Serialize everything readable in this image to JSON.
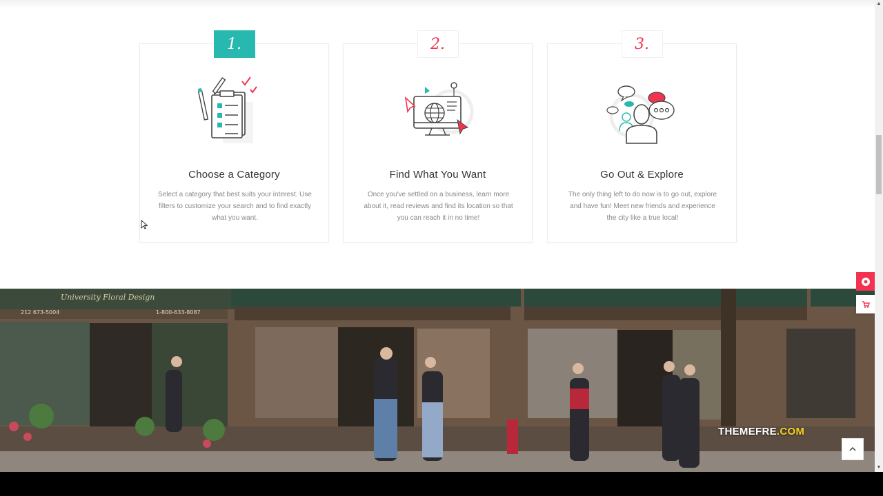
{
  "steps": [
    {
      "number": "1.",
      "title": "Choose a Category",
      "description": "Select a category that best suits your interest. Use filters to customize your search and to find exactly what you want.",
      "icon": "checklist-icon"
    },
    {
      "number": "2.",
      "title": "Find What You Want",
      "description": "Once you've settled on a business, learn more about it, read reviews and find its location so that you can reach it in no time!",
      "icon": "globe-monitor-icon"
    },
    {
      "number": "3.",
      "title": "Go Out & Explore",
      "description": "The only thing left to do now is to go out, explore and have fun! Meet new friends and experience the city like a true local!",
      "icon": "people-chat-icon"
    }
  ],
  "watermark": {
    "text": "THEMEFRE",
    "suffix": ".COM"
  },
  "photo": {
    "shop_sign": "University Floral Design",
    "phone_left": "212 673-5004",
    "phone_right": "1-800-633-8087"
  },
  "colors": {
    "accent_teal": "#27b8b0",
    "accent_red": "#f2324f"
  }
}
